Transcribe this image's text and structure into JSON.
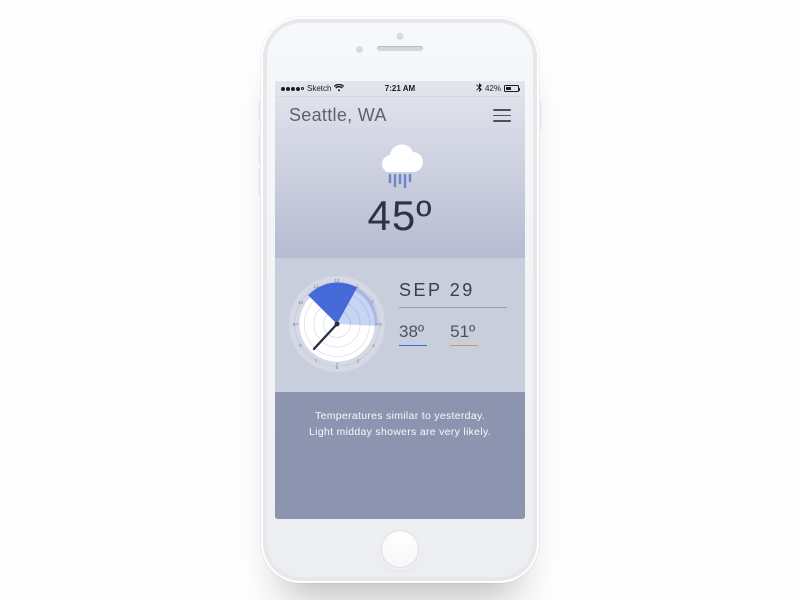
{
  "statusbar": {
    "carrier": "Sketch",
    "time": "7:21 AM",
    "battery_pct": "42%"
  },
  "header": {
    "location": "Seattle, WA"
  },
  "hero": {
    "temperature": "45º",
    "condition_icon": "rain-cloud-icon"
  },
  "detail": {
    "date": "SEP 29",
    "low": "38º",
    "high": "51º"
  },
  "summary": {
    "line1": "Temperatures similar to yesterday.",
    "line2": "Light midday showers are very likely."
  }
}
